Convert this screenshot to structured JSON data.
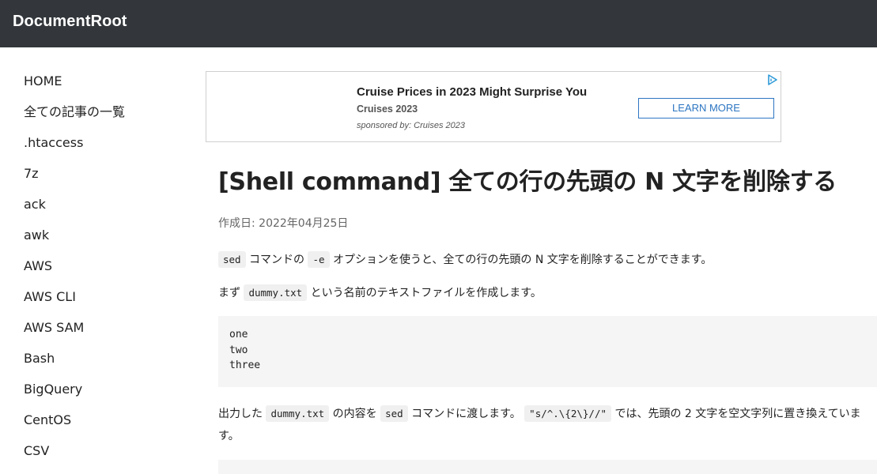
{
  "header": {
    "brand": "DocumentRoot"
  },
  "sidebar": {
    "items": [
      {
        "label": "HOME"
      },
      {
        "label": "全ての記事の一覧"
      },
      {
        "label": ".htaccess"
      },
      {
        "label": "7z"
      },
      {
        "label": "ack"
      },
      {
        "label": "awk"
      },
      {
        "label": "AWS"
      },
      {
        "label": "AWS CLI"
      },
      {
        "label": "AWS SAM"
      },
      {
        "label": "Bash"
      },
      {
        "label": "BigQuery"
      },
      {
        "label": "CentOS"
      },
      {
        "label": "CSV"
      }
    ]
  },
  "ad": {
    "title": "Cruise Prices in 2023 Might Surprise You",
    "source": "Cruises 2023",
    "sponsor": "sponsored by: Cruises 2023",
    "button_label": "LEARN MORE",
    "icon": "adchoices-icon",
    "accent_color": "#2d76c2"
  },
  "article": {
    "title": "[Shell command] 全ての行の先頭の N 文字を削除する",
    "date_label": "作成日: ",
    "date_value": "2022年04月25日",
    "p1": {
      "code1": "sed",
      "text1": " コマンドの ",
      "code2": "-e",
      "text2": " オプションを使うと、全ての行の先頭の N 文字を削除することができます。"
    },
    "p2": {
      "text1": "まず ",
      "code1": "dummy.txt",
      "text2": " という名前のテキストファイルを作成します。"
    },
    "codeblock": "one\ntwo\nthree",
    "p3": {
      "text1": "出力した ",
      "code1": "dummy.txt",
      "text2": " の内容を ",
      "code2": "sed",
      "text3": " コマンドに渡します。 ",
      "code3": "\"s/^.\\{2\\}//\"",
      "text4": " では、先頭の 2 文字を空文字列に置き換えています。"
    }
  },
  "colors": {
    "topbar": "#33373b",
    "code_bg": "#f0f0f0"
  }
}
